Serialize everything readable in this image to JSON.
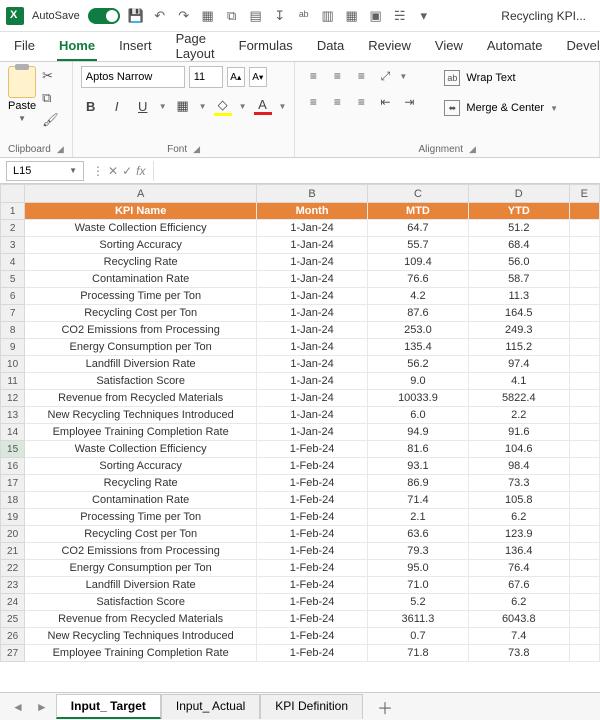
{
  "titlebar": {
    "autosave": "AutoSave",
    "autosave_state": "On",
    "filename": "Recycling KPI..."
  },
  "tabs": [
    "File",
    "Home",
    "Insert",
    "Page Layout",
    "Formulas",
    "Data",
    "Review",
    "View",
    "Automate",
    "Developer"
  ],
  "active_tab": "Home",
  "clipboard": {
    "paste": "Paste",
    "label": "Clipboard"
  },
  "font": {
    "name": "Aptos Narrow",
    "size": "11",
    "inc": "A",
    "dec": "A",
    "label": "Font"
  },
  "alignment": {
    "wrap": "Wrap Text",
    "merge": "Merge & Center",
    "label": "Alignment"
  },
  "namebox": "L15",
  "fx": "fx",
  "columns": [
    "A",
    "B",
    "C",
    "D",
    "E"
  ],
  "header_row": [
    "KPI Name",
    "Month",
    "MTD",
    "YTD"
  ],
  "rows": [
    {
      "n": 2,
      "a": "Waste Collection Efficiency",
      "b": "1-Jan-24",
      "c": "64.7",
      "d": "51.2"
    },
    {
      "n": 3,
      "a": "Sorting Accuracy",
      "b": "1-Jan-24",
      "c": "55.7",
      "d": "68.4"
    },
    {
      "n": 4,
      "a": "Recycling Rate",
      "b": "1-Jan-24",
      "c": "109.4",
      "d": "56.0"
    },
    {
      "n": 5,
      "a": "Contamination Rate",
      "b": "1-Jan-24",
      "c": "76.6",
      "d": "58.7"
    },
    {
      "n": 6,
      "a": "Processing Time per Ton",
      "b": "1-Jan-24",
      "c": "4.2",
      "d": "11.3"
    },
    {
      "n": 7,
      "a": "Recycling Cost per Ton",
      "b": "1-Jan-24",
      "c": "87.6",
      "d": "164.5"
    },
    {
      "n": 8,
      "a": "CO2 Emissions from Processing",
      "b": "1-Jan-24",
      "c": "253.0",
      "d": "249.3"
    },
    {
      "n": 9,
      "a": "Energy Consumption per Ton",
      "b": "1-Jan-24",
      "c": "135.4",
      "d": "115.2"
    },
    {
      "n": 10,
      "a": "Landfill Diversion Rate",
      "b": "1-Jan-24",
      "c": "56.2",
      "d": "97.4"
    },
    {
      "n": 11,
      "a": "Satisfaction Score",
      "b": "1-Jan-24",
      "c": "9.0",
      "d": "4.1"
    },
    {
      "n": 12,
      "a": "Revenue from Recycled Materials",
      "b": "1-Jan-24",
      "c": "10033.9",
      "d": "5822.4"
    },
    {
      "n": 13,
      "a": "New Recycling Techniques Introduced",
      "b": "1-Jan-24",
      "c": "6.0",
      "d": "2.2"
    },
    {
      "n": 14,
      "a": "Employee Training Completion Rate",
      "b": "1-Jan-24",
      "c": "94.9",
      "d": "91.6"
    },
    {
      "n": 15,
      "a": "Waste Collection Efficiency",
      "b": "1-Feb-24",
      "c": "81.6",
      "d": "104.6"
    },
    {
      "n": 16,
      "a": "Sorting Accuracy",
      "b": "1-Feb-24",
      "c": "93.1",
      "d": "98.4"
    },
    {
      "n": 17,
      "a": "Recycling Rate",
      "b": "1-Feb-24",
      "c": "86.9",
      "d": "73.3"
    },
    {
      "n": 18,
      "a": "Contamination Rate",
      "b": "1-Feb-24",
      "c": "71.4",
      "d": "105.8"
    },
    {
      "n": 19,
      "a": "Processing Time per Ton",
      "b": "1-Feb-24",
      "c": "2.1",
      "d": "6.2"
    },
    {
      "n": 20,
      "a": "Recycling Cost per Ton",
      "b": "1-Feb-24",
      "c": "63.6",
      "d": "123.9"
    },
    {
      "n": 21,
      "a": "CO2 Emissions from Processing",
      "b": "1-Feb-24",
      "c": "79.3",
      "d": "136.4"
    },
    {
      "n": 22,
      "a": "Energy Consumption per Ton",
      "b": "1-Feb-24",
      "c": "95.0",
      "d": "76.4"
    },
    {
      "n": 23,
      "a": "Landfill Diversion Rate",
      "b": "1-Feb-24",
      "c": "71.0",
      "d": "67.6"
    },
    {
      "n": 24,
      "a": "Satisfaction Score",
      "b": "1-Feb-24",
      "c": "5.2",
      "d": "6.2"
    },
    {
      "n": 25,
      "a": "Revenue from Recycled Materials",
      "b": "1-Feb-24",
      "c": "3611.3",
      "d": "6043.8"
    },
    {
      "n": 26,
      "a": "New Recycling Techniques Introduced",
      "b": "1-Feb-24",
      "c": "0.7",
      "d": "7.4"
    },
    {
      "n": 27,
      "a": "Employee Training Completion Rate",
      "b": "1-Feb-24",
      "c": "71.8",
      "d": "73.8"
    }
  ],
  "sheets": [
    "Input_ Target",
    "Input_ Actual",
    "KPI Definition"
  ],
  "active_sheet": 0
}
